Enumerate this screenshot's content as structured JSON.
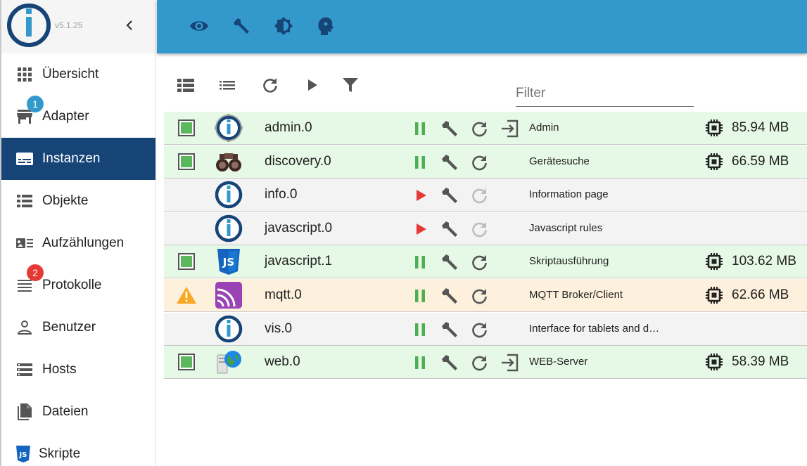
{
  "app": {
    "version": "v5.1.25"
  },
  "sidebar": {
    "items": [
      {
        "label": "Übersicht",
        "icon": "grid-icon"
      },
      {
        "label": "Adapter",
        "icon": "store-icon",
        "badge": "1"
      },
      {
        "label": "Instanzen",
        "icon": "instances-icon",
        "active": true
      },
      {
        "label": "Objekte",
        "icon": "list-icon"
      },
      {
        "label": "Aufzählungen",
        "icon": "enum-icon"
      },
      {
        "label": "Protokolle",
        "icon": "log-icon",
        "badge": "2"
      },
      {
        "label": "Benutzer",
        "icon": "user-icon"
      },
      {
        "label": "Hosts",
        "icon": "hosts-icon"
      },
      {
        "label": "Dateien",
        "icon": "files-icon"
      },
      {
        "label": "Skripte",
        "icon": "js-icon"
      }
    ]
  },
  "topbar": {
    "icons": [
      "eye-icon",
      "wrench-icon",
      "brightness-icon",
      "expert-mode-icon"
    ]
  },
  "toolbar": {
    "filter_placeholder": "Filter",
    "icons": [
      "view-table-icon",
      "view-list-icon",
      "refresh-icon",
      "play-icon",
      "filter-icon"
    ]
  },
  "instances": [
    {
      "name": "admin.0",
      "description": "Admin",
      "memory": "85.94 MB",
      "status": "green",
      "running": true,
      "link": true,
      "icon": "iobroker-gear-icon"
    },
    {
      "name": "discovery.0",
      "description": "Gerätesuche",
      "memory": "66.59 MB",
      "status": "green",
      "running": true,
      "link": false,
      "icon": "binoculars-icon"
    },
    {
      "name": "info.0",
      "description": "Information page",
      "memory": "",
      "status": "gray",
      "running": false,
      "link": false,
      "icon": "iobroker-icon"
    },
    {
      "name": "javascript.0",
      "description": "Javascript rules",
      "memory": "",
      "status": "gray",
      "running": false,
      "link": false,
      "icon": "iobroker-icon"
    },
    {
      "name": "javascript.1",
      "description": "Skriptausführung",
      "memory": "103.62 MB",
      "status": "green",
      "running": true,
      "link": false,
      "icon": "js-shield-icon"
    },
    {
      "name": "mqtt.0",
      "description": "MQTT Broker/Client",
      "memory": "62.66 MB",
      "status": "orange",
      "running": true,
      "link": false,
      "icon": "mqtt-icon"
    },
    {
      "name": "vis.0",
      "description": "Interface for tablets and d…",
      "memory": "",
      "status": "gray",
      "running": true,
      "link": false,
      "icon": "iobroker-icon"
    },
    {
      "name": "web.0",
      "description": "WEB-Server",
      "memory": "58.39 MB",
      "status": "green",
      "running": true,
      "link": true,
      "icon": "globe-server-icon"
    }
  ],
  "colors": {
    "topbar": "#3399cc",
    "sidebar_active": "#164477",
    "row_green": "#e6f9e6",
    "row_gray": "#f3f3f3",
    "row_orange": "#fdf0dc",
    "badge_blue": "#3399cc",
    "badge_red": "#e53935",
    "running": "#4caf50",
    "stopped": "#e53935"
  }
}
